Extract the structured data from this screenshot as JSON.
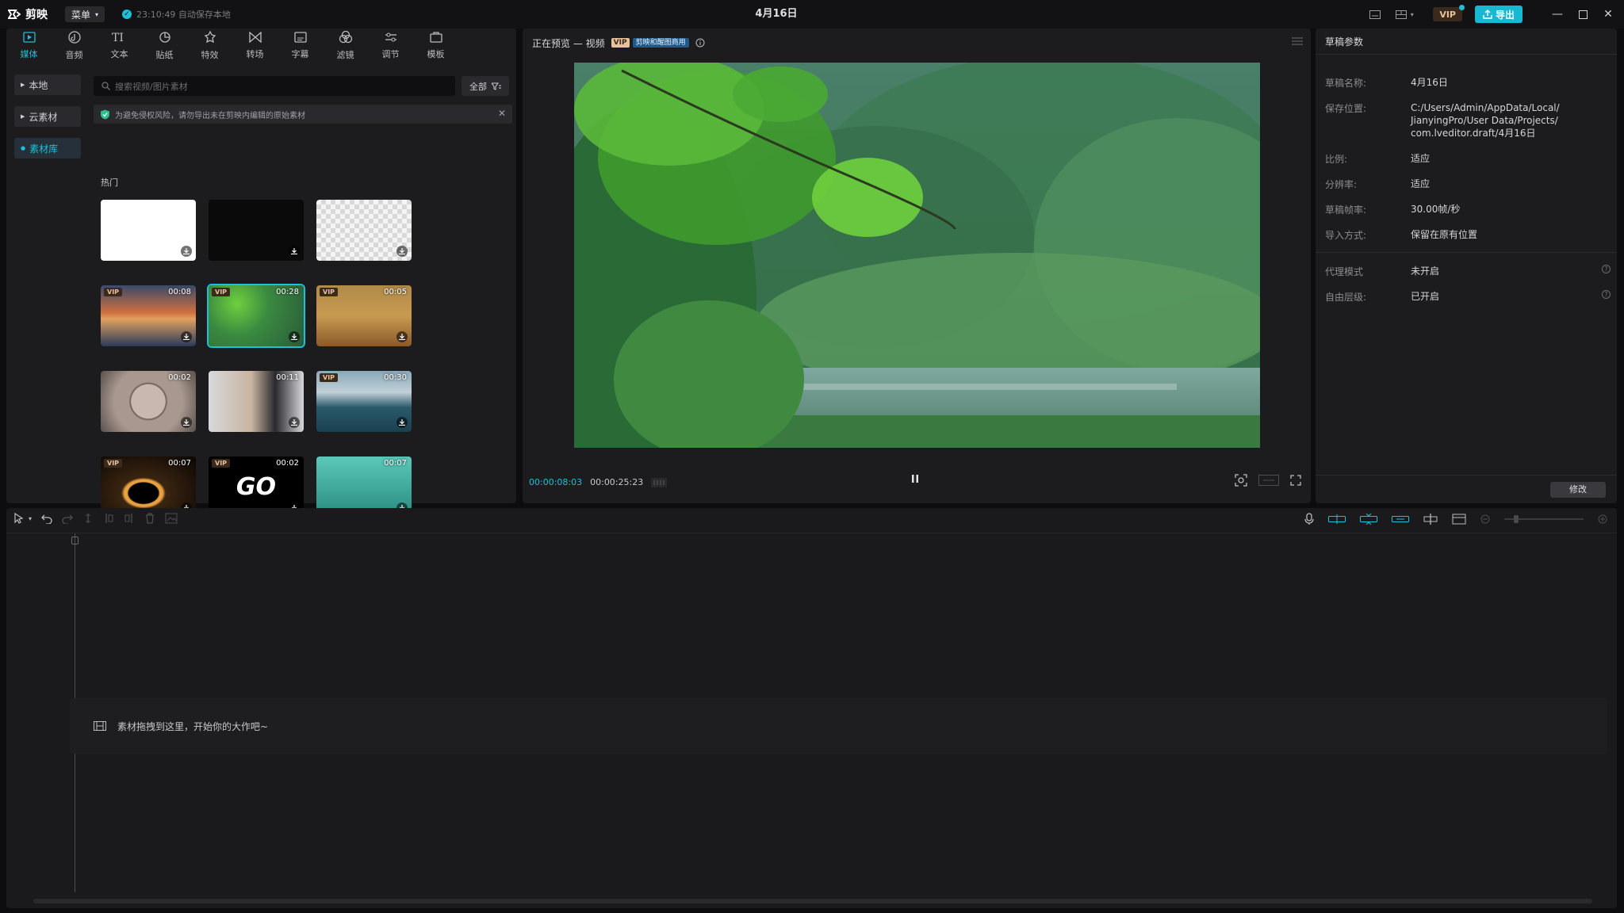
{
  "app": {
    "name": "剪映",
    "menu_label": "菜单",
    "autosave": "23:10:49 自动保存本地",
    "doc_title": "4月16日",
    "vip": "VIP",
    "export": "导出"
  },
  "toolbar": [
    {
      "label": "媒体",
      "icon": "media-icon",
      "active": true
    },
    {
      "label": "音频",
      "icon": "audio-icon"
    },
    {
      "label": "文本",
      "icon": "text-icon"
    },
    {
      "label": "贴纸",
      "icon": "sticker-icon"
    },
    {
      "label": "特效",
      "icon": "effects-icon"
    },
    {
      "label": "转场",
      "icon": "transition-icon"
    },
    {
      "label": "字幕",
      "icon": "subtitle-icon"
    },
    {
      "label": "滤镜",
      "icon": "filter-icon"
    },
    {
      "label": "调节",
      "icon": "adjust-icon"
    },
    {
      "label": "模板",
      "icon": "template-icon"
    }
  ],
  "sidebar": {
    "items": [
      {
        "label": "本地"
      },
      {
        "label": "云素材"
      },
      {
        "label": "素材库",
        "active": true
      }
    ]
  },
  "search": {
    "placeholder": "搜索视频/图片素材",
    "filter_label": "全部"
  },
  "notice": {
    "text": "为避免侵权风险，请勿导出未在剪映内编辑的原始素材"
  },
  "library": {
    "section": "热门",
    "items": [
      {
        "name": "white",
        "duration": "",
        "vip": false,
        "color": "#ffffff"
      },
      {
        "name": "black",
        "duration": "",
        "vip": false,
        "color": "#0a0a0a"
      },
      {
        "name": "transparent",
        "duration": "",
        "vip": false,
        "color": "#dcdcdc"
      },
      {
        "name": "sunset",
        "duration": "00:08",
        "vip": true,
        "color": "#b0603e"
      },
      {
        "name": "forest",
        "duration": "00:28",
        "vip": true,
        "color": "#3e7a4c",
        "selected": true
      },
      {
        "name": "wheat",
        "duration": "00:05",
        "vip": true,
        "color": "#a67a3a"
      },
      {
        "name": "countdown",
        "duration": "00:02",
        "vip": false,
        "color": "#8a7f78"
      },
      {
        "name": "man",
        "duration": "00:11",
        "vip": false,
        "color": "#b8b8bc"
      },
      {
        "name": "ocean",
        "duration": "00:30",
        "vip": true,
        "color": "#4c6e82"
      },
      {
        "name": "fire-ring",
        "duration": "00:07",
        "vip": true,
        "color": "#3a2410"
      },
      {
        "name": "go",
        "duration": "00:02",
        "vip": true,
        "color": "#000000",
        "text": "GO"
      },
      {
        "name": "hand",
        "duration": "00:07",
        "vip": false,
        "color": "#3aa898"
      }
    ]
  },
  "preview": {
    "title": "正在预览 — 视频",
    "vip": "VIP",
    "tag": "剪映和醒图商用",
    "current_time": "00:00:08:03",
    "total_time": "00:00:25:23"
  },
  "params": {
    "title": "草稿参数",
    "rows": [
      {
        "key": "草稿名称:",
        "value": "4月16日"
      },
      {
        "key": "保存位置:",
        "value": "C:/Users/Admin/AppData/Local/\nJianyingPro/User Data/Projects/\ncom.lveditor.draft/4月16日"
      },
      {
        "key": "比例:",
        "value": "适应"
      },
      {
        "key": "分辨率:",
        "value": "适应"
      },
      {
        "key": "草稿帧率:",
        "value": "30.00帧/秒"
      },
      {
        "key": "导入方式:",
        "value": "保留在原有位置"
      },
      {
        "key": "代理模式",
        "value": "未开启"
      },
      {
        "key": "自由层级:",
        "value": "已开启"
      }
    ],
    "edit_label": "修改"
  },
  "timeline": {
    "drop_hint": "素材拖拽到这里，开始你的大作吧~"
  }
}
